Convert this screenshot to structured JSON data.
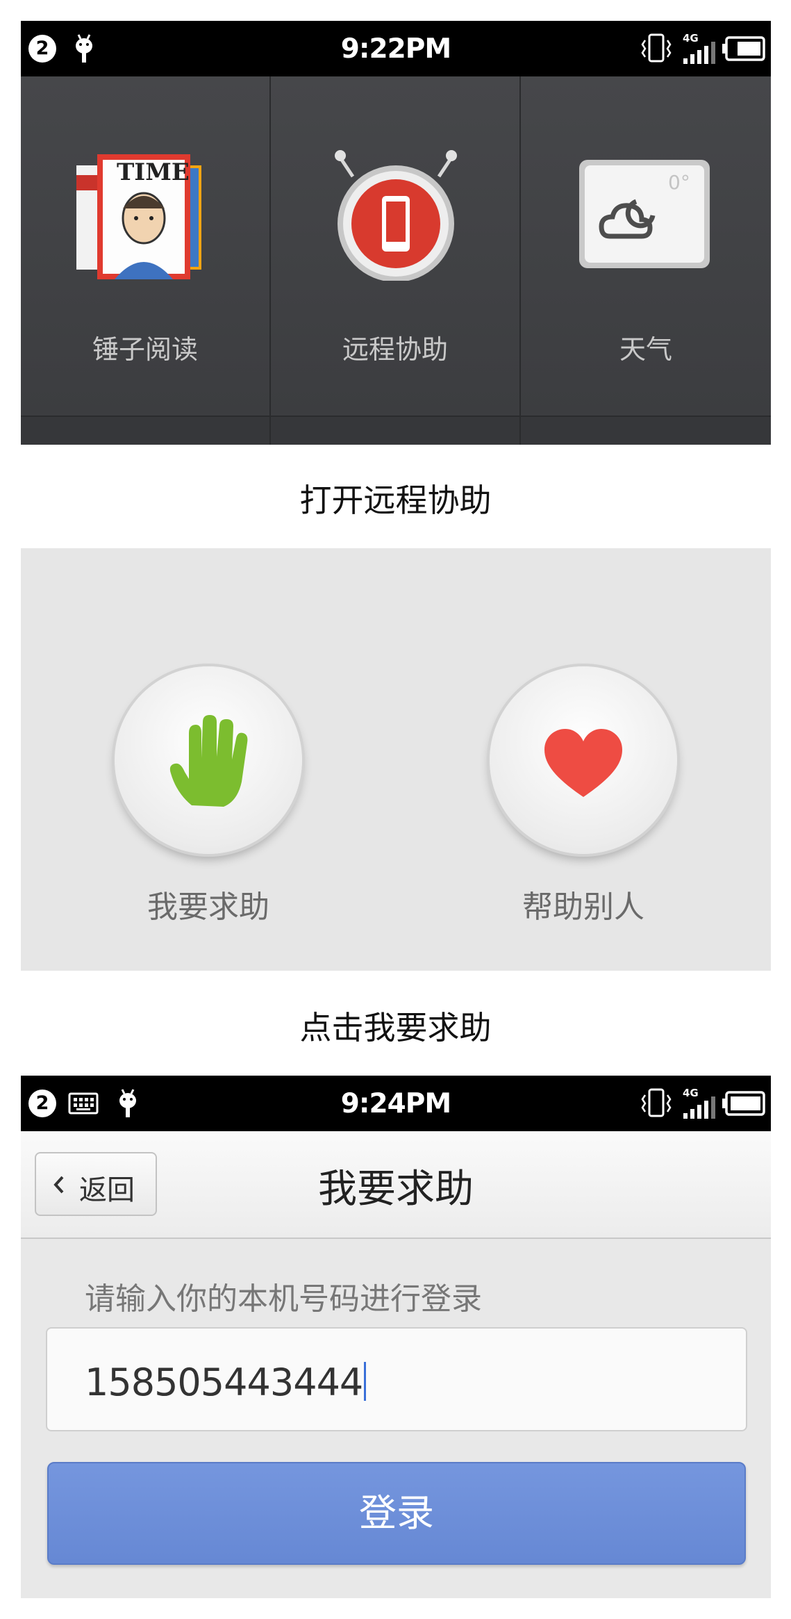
{
  "screen1": {
    "status": {
      "badge": "2",
      "time": "9:22PM",
      "network": "4G"
    },
    "apps": [
      {
        "label": "锤子阅读",
        "icon": "magazine-icon",
        "cover_text": "TIME"
      },
      {
        "label": "远程协助",
        "icon": "remote-assist-icon"
      },
      {
        "label": "天气",
        "icon": "weather-icon",
        "temperature": "0°"
      }
    ]
  },
  "caption1": "打开远程协助",
  "screen2": {
    "options": [
      {
        "label": "我要求助",
        "icon": "hand-icon",
        "color": "#7cbd2f"
      },
      {
        "label": "帮助别人",
        "icon": "heart-icon",
        "color": "#ee4c43"
      }
    ]
  },
  "caption2": "点击我要求助",
  "screen3": {
    "status": {
      "badge": "2",
      "time": "9:24PM",
      "network": "4G"
    },
    "back_label": "返回",
    "title": "我要求助",
    "hint": "请输入你的本机号码进行登录",
    "phone_value": "158505443444",
    "login_label": "登录",
    "accent": "#6a8bd6"
  }
}
